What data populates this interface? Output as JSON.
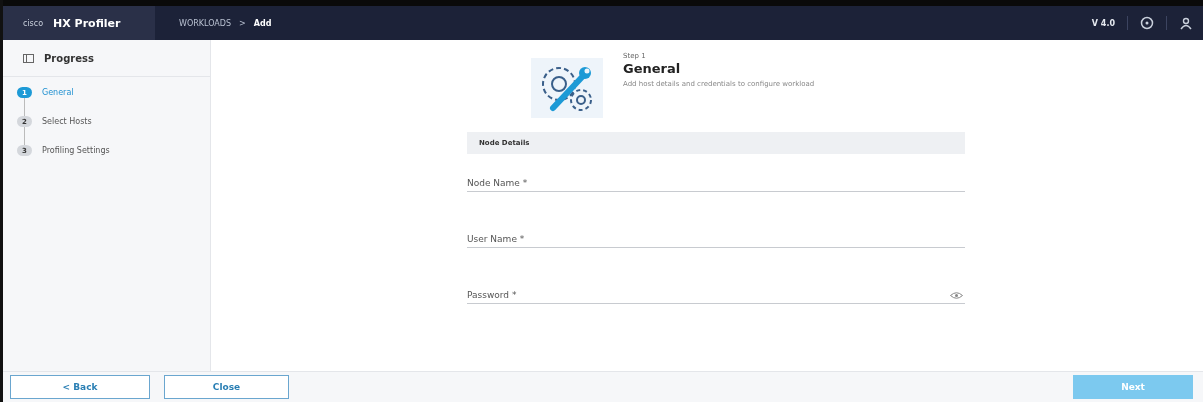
{
  "header": {
    "logo": "cisco",
    "product": "HX Profiler",
    "breadcrumb": [
      {
        "label": "WORKLOADS"
      },
      {
        "label": "Add"
      }
    ],
    "separator": ">",
    "version": "V 4.0"
  },
  "sidebar": {
    "title": "Progress",
    "steps": [
      {
        "number": "1",
        "label": "General",
        "selected": true
      },
      {
        "number": "2",
        "label": "Select Hosts",
        "selected": false
      },
      {
        "number": "3",
        "label": "Profiling Settings",
        "selected": false
      }
    ]
  },
  "step": {
    "overline": "Step 1",
    "title": "General",
    "description": "Add host details and credentials to configure workload"
  },
  "section": {
    "title": "Node Details"
  },
  "fields": [
    {
      "kind": "text",
      "placeholder": "Node Name *"
    },
    {
      "kind": "text",
      "placeholder": "User Name *"
    },
    {
      "kind": "password",
      "placeholder": "Password *"
    }
  ],
  "footer": {
    "back": "< Back",
    "close": "Close",
    "next": {
      "label": "Next",
      "disabled": true
    }
  }
}
